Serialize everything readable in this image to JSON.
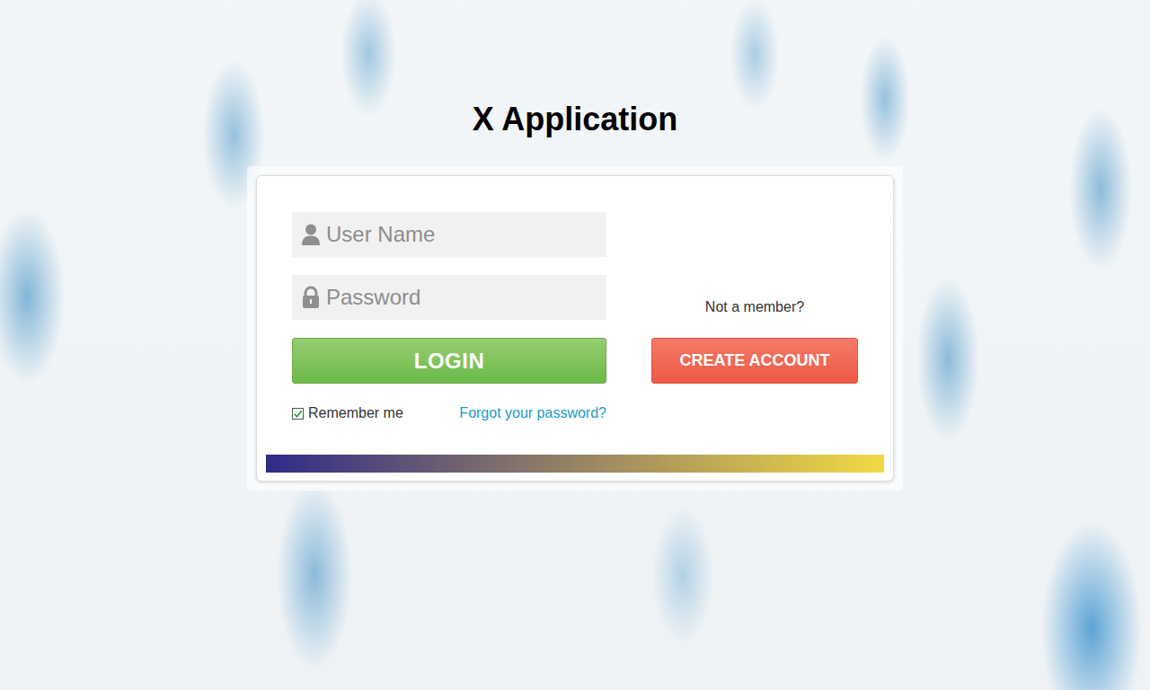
{
  "title": "X Application",
  "fields": [
    {
      "placeholder": "User Name",
      "kind": "text"
    },
    {
      "placeholder": "Password",
      "kind": "password"
    }
  ],
  "login_button": "LOGIN",
  "remember_me": {
    "label": "Remember me",
    "checked": true
  },
  "forgot_password": "Forgot your password?",
  "signup": {
    "prompt": "Not a member?",
    "button": "CREATE ACCOUNT"
  }
}
